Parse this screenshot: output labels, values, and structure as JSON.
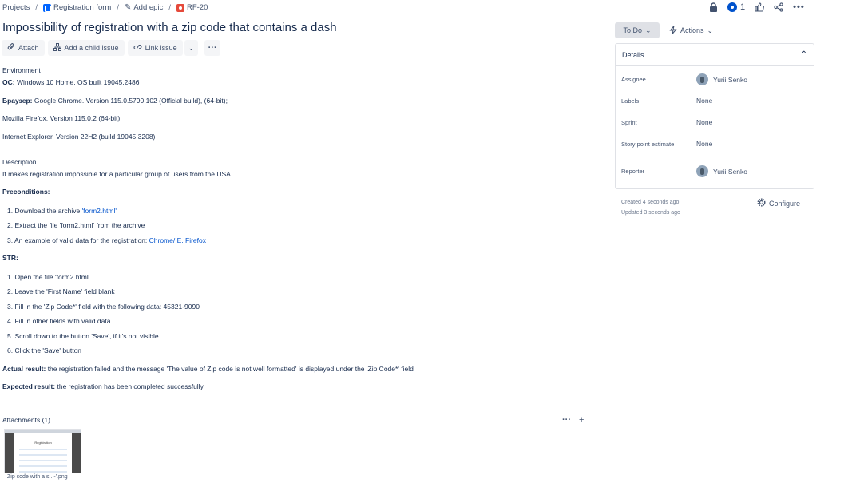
{
  "breadcrumb": {
    "projects": "Projects",
    "project": "Registration form",
    "epic": "Add epic",
    "issue_key": "RF-20"
  },
  "header": {
    "watch_count": "1"
  },
  "issue": {
    "title": "Impossibility of registration with a zip code that contains a dash"
  },
  "toolbar": {
    "attach": "Attach",
    "add_child": "Add a child issue",
    "link_issue": "Link issue"
  },
  "environment": {
    "label": "Environment",
    "os_label": "ОС:",
    "os_value": " Windows 10 Home, OS built 19045.2486",
    "browser_label": "Браузер:",
    "browser_value": " Google Chrome. Version 115.0.5790.102 (Official build), (64-bit);",
    "firefox": "Mozilla Firefox. Version 115.0.2 (64-bit);",
    "ie": "Internet Explorer. Version 22H2 (build 19045.3208)"
  },
  "description": {
    "label": "Description",
    "text": "It makes registration impossible for a particular group of users from the USA.",
    "preconditions_label": "Preconditions:",
    "pre1_prefix": "1. Download the archive ",
    "pre1_link": "'form2.html'",
    "pre2": "2. Extract the file 'form2.html' from the archive",
    "pre3_prefix": "3. An example of valid data for the registration: ",
    "pre3_link": "Chrome/IE, Firefox",
    "str_label": "STR:",
    "steps": [
      "1. Open the file 'form2.html'",
      "2. Leave the 'First Name' field blank",
      "3. Fill in the 'Zip Code*' field with the following data: 45321-9090",
      "4. Fill in other fields with valid data",
      "5. Scroll down to the button 'Save', if it's not visible",
      "6. Click the 'Save' button"
    ],
    "actual_label": "Actual result:",
    "actual_value": " the registration failed and the message 'The value of Zip code is not well formatted' is displayed under the 'Zip Code*' field",
    "expected_label": "Expected result:",
    "expected_value": " the registration has been completed successfully"
  },
  "attachments": {
    "label": "Attachments (1)",
    "file_name": "Zip code with a s...-'.png",
    "thumb_title": "Registration"
  },
  "sidebar": {
    "status": "To Do",
    "actions": "Actions",
    "details_title": "Details",
    "assignee_label": "Assignee",
    "assignee_value": "Yurii Senko",
    "labels_label": "Labels",
    "labels_value": "None",
    "sprint_label": "Sprint",
    "sprint_value": "None",
    "story_label": "Story point estimate",
    "story_value": "None",
    "reporter_label": "Reporter",
    "reporter_value": "Yurii Senko",
    "created": "Created 4 seconds ago",
    "updated": "Updated 3 seconds ago",
    "configure": "Configure"
  }
}
